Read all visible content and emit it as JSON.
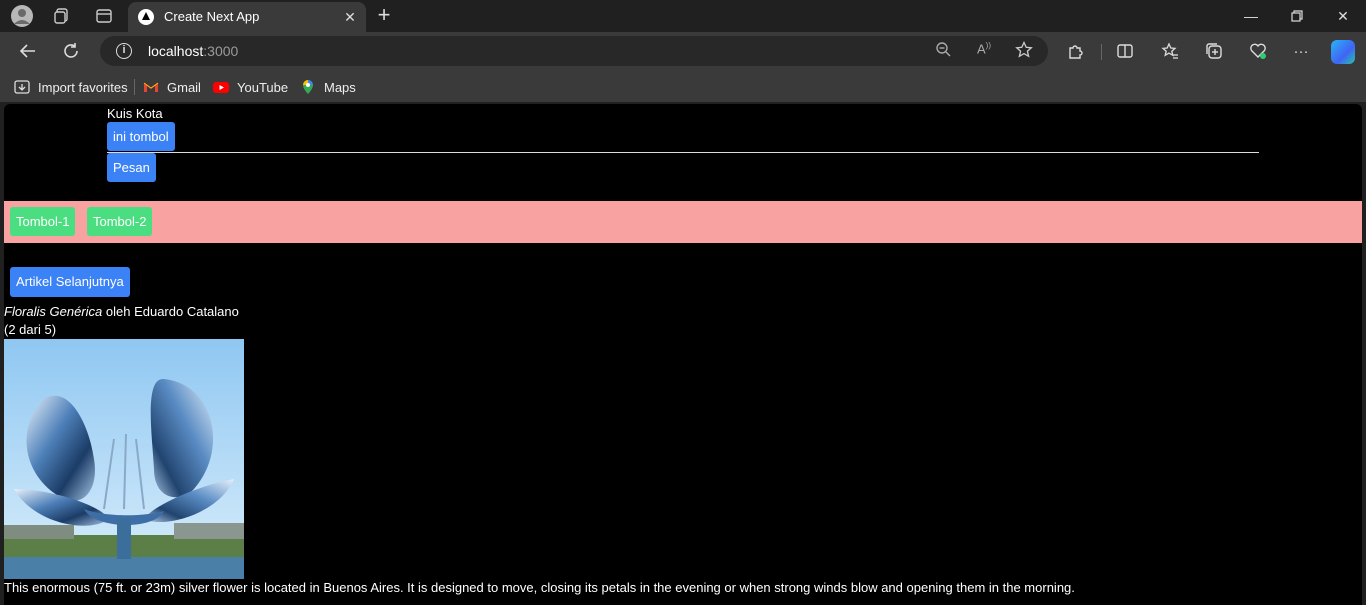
{
  "browser": {
    "tab_title": "Create Next App",
    "url_host": "localhost",
    "url_port": ":3000",
    "bookmarks": [
      {
        "label": "Import favorites",
        "icon": "import-icon"
      },
      {
        "label": "Gmail",
        "icon": "gmail-icon"
      },
      {
        "label": "YouTube",
        "icon": "youtube-icon"
      },
      {
        "label": "Maps",
        "icon": "maps-icon"
      }
    ]
  },
  "page": {
    "quiz_title": "Kuis Kota",
    "button_ini_tombol": "ini tombol",
    "button_pesan": "Pesan",
    "toolbar_buttons": [
      "Tombol-1",
      "Tombol-2"
    ],
    "button_next_article": "Artikel Selanjutnya",
    "artwork_title": "Floralis Genérica",
    "artwork_by": " oleh Eduardo Catalano",
    "counter": "(2 dari 5)",
    "description": "This enormous (75 ft. or 23m) silver flower is located in Buenos Aires. It is designed to move, closing its petals in the evening or when strong winds blow and opening them in the morning."
  },
  "colors": {
    "blue_button": "#3b82f6",
    "green_button": "#4ade80",
    "pink_bar": "#f8a2a2",
    "page_background": "#000000"
  }
}
